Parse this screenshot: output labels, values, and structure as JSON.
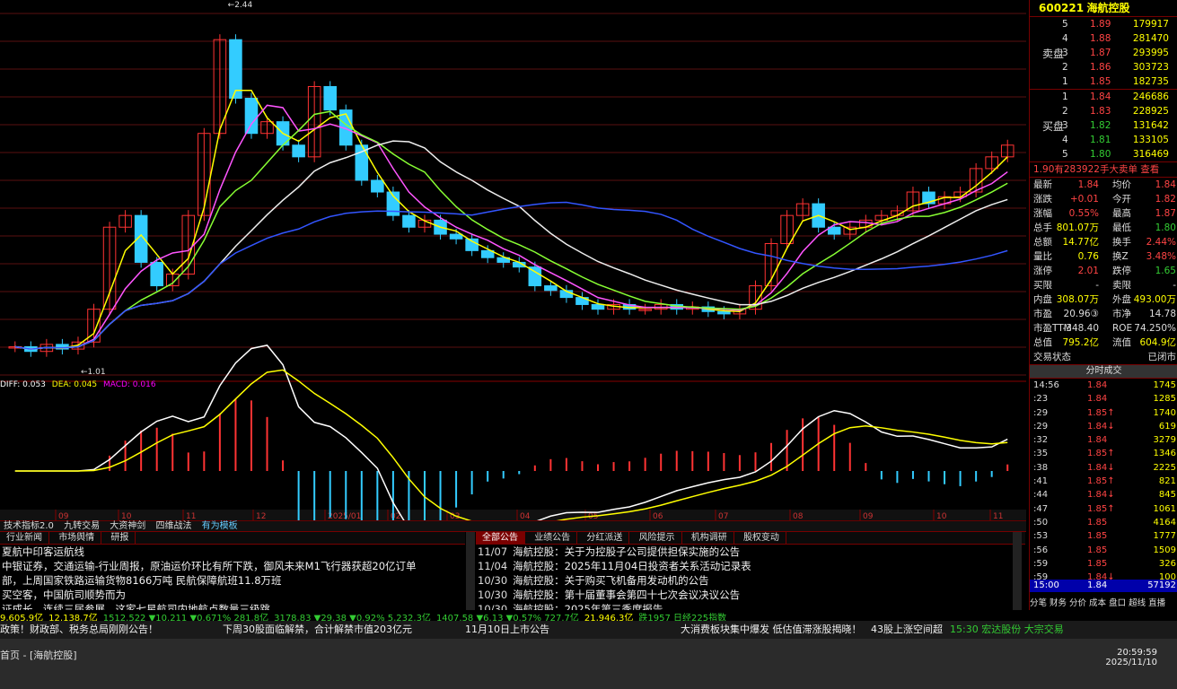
{
  "chart_data": {
    "type": "line",
    "title": "",
    "xlabel": "",
    "ylabel": "",
    "x_ticks": [
      "09",
      "10",
      "11",
      "12",
      "2025/01",
      "02",
      "03",
      "04",
      "05",
      "06",
      "07",
      "08",
      "09",
      "10",
      "11"
    ],
    "price_annotations": {
      "high": "2.44",
      "low": "1.01"
    },
    "candles": [
      1.04,
      1.02,
      1.05,
      1.03,
      1.06,
      1.2,
      1.55,
      1.6,
      1.4,
      1.3,
      1.35,
      1.6,
      1.95,
      2.35,
      2.1,
      1.95,
      2.0,
      1.9,
      1.85,
      2.15,
      2.05,
      1.9,
      1.75,
      1.7,
      1.6,
      1.55,
      1.58,
      1.52,
      1.5,
      1.45,
      1.42,
      1.4,
      1.38,
      1.3,
      1.28,
      1.25,
      1.22,
      1.2,
      1.22,
      1.2,
      1.2,
      1.22,
      1.2,
      1.21,
      1.19,
      1.18,
      1.2,
      1.3,
      1.48,
      1.6,
      1.65,
      1.55,
      1.52,
      1.55,
      1.58,
      1.6,
      1.62,
      1.7,
      1.65,
      1.68,
      1.7,
      1.8,
      1.85,
      1.9
    ],
    "macd": {
      "label_diff": "DIFF: 0.053",
      "label_dea": "DEA: 0.045",
      "label_macd": "MACD: 0.016"
    }
  },
  "bottom_tabs": [
    "技术指标2.0",
    "九转交易",
    "大资神剑",
    "四维战法",
    "有为模板"
  ],
  "left_news": {
    "tabs": [
      "行业新闻",
      "市场舆情",
      "研报"
    ],
    "lines": [
      "夏航中印客运航线",
      "中银证券，交通运输-行业周报，原油运价环比有所下跌，御风未来M1飞行器获超20亿订单",
      "部，上周国家铁路运输货物8166万吨 民航保障航班11.8万班",
      "买空客，中国航司顺势而为",
      "证成长，连续三届参展，这家七星航司内地航点数量三级跳"
    ]
  },
  "right_news": {
    "tabs": [
      "全部公告",
      "业绩公告",
      "分红派送",
      "风险提示",
      "机构调研",
      "股权变动"
    ],
    "items": [
      {
        "date": "11/07",
        "text": "海航控股：关于为控股子公司提供担保实施的公告"
      },
      {
        "date": "11/04",
        "text": "海航控股：2025年11月04日投资者关系活动记录表"
      },
      {
        "date": "10/30",
        "text": "海航控股：关于购买飞机备用发动机的公告"
      },
      {
        "date": "10/30",
        "text": "海航控股：第十届董事会第四十七次会议决议公告"
      },
      {
        "date": "10/30",
        "text": "海航控股：2025年第三季度报告"
      }
    ]
  },
  "ticker": [
    {
      "text": "9,605.9亿",
      "color": "#ff0"
    },
    {
      "text": "12,138.7亿",
      "color": "#ff0"
    },
    {
      "text": "1512.522 ▼10.211 ▼0.671% 281.8亿",
      "color": "#3c3"
    },
    {
      "text": "3178.83 ▼29.38 ▼0.92% 5,232.3亿",
      "color": "#3c3"
    },
    {
      "text": "1407.58 ▼6.13 ▼0.57% 727.7亿",
      "color": "#3c3"
    },
    {
      "text": "21,946.3亿",
      "color": "#ff0"
    },
    {
      "text": "跌1957 日经225指数",
      "color": "#3c3"
    }
  ],
  "marquee": [
    "政策！财政部、税务总局刚刚公告！",
    "下周30股面临解禁，合计解禁市值203亿元",
    "11月10日上市公告",
    "大消费板块集中爆发 低估值滞涨股揭晓！",
    "43股上涨空间超",
    "15:30 宏达股份 大宗交易"
  ],
  "taskbar": {
    "left": "首页 - [海航控股]",
    "time": "20:59:59",
    "date": "2025/11/10"
  },
  "stock": {
    "code": "600221",
    "name": "海航控股"
  },
  "orderbook": {
    "sell_label": "卖盘",
    "buy_label": "买盘",
    "sell": [
      {
        "lv": "5",
        "px": "1.89",
        "vol": "179917"
      },
      {
        "lv": "4",
        "px": "1.88",
        "vol": "281470"
      },
      {
        "lv": "3",
        "px": "1.87",
        "vol": "293995"
      },
      {
        "lv": "2",
        "px": "1.86",
        "vol": "303723"
      },
      {
        "lv": "1",
        "px": "1.85",
        "vol": "182735"
      }
    ],
    "buy": [
      {
        "lv": "1",
        "px": "1.84",
        "vol": "246686"
      },
      {
        "lv": "2",
        "px": "1.83",
        "vol": "228925"
      },
      {
        "lv": "3",
        "px": "1.82",
        "vol": "131642"
      },
      {
        "lv": "4",
        "px": "1.81",
        "vol": "133105"
      },
      {
        "lv": "5",
        "px": "1.80",
        "vol": "316469"
      }
    ],
    "summary": "1.90有283922手大卖单 查看"
  },
  "quotes": [
    {
      "k1": "最新",
      "v1": "1.84",
      "k2": "均价",
      "v2": "1.84"
    },
    {
      "k1": "涨跌",
      "v1": "+0.01",
      "k2": "今开",
      "v2": "1.82"
    },
    {
      "k1": "涨幅",
      "v1": "0.55%",
      "k2": "最高",
      "v2": "1.87"
    },
    {
      "k1": "总手",
      "v1": "801.07万",
      "k2": "最低",
      "v2": "1.80"
    },
    {
      "k1": "总额",
      "v1": "14.77亿",
      "k2": "换手",
      "v2": "2.44%"
    },
    {
      "k1": "量比",
      "v1": "0.76",
      "k2": "换Z",
      "v2": "3.48%"
    },
    {
      "k1": "涨停",
      "v1": "2.01",
      "k2": "跌停",
      "v2": "1.65"
    },
    {
      "k1": "买限",
      "v1": "-",
      "k2": "卖限",
      "v2": "-"
    },
    {
      "k1": "内盘",
      "v1": "308.07万",
      "k2": "外盘",
      "v2": "493.00万"
    },
    {
      "k1": "市盈",
      "v1": "20.96③",
      "k2": "市净",
      "v2": "14.78"
    },
    {
      "k1": "市盈TTM",
      "v1": "-348.40",
      "k2": "ROE",
      "v2": "74.250%"
    },
    {
      "k1": "总值",
      "v1": "795.2亿",
      "k2": "流值",
      "v2": "604.9亿"
    },
    {
      "k1": "交易状态",
      "v1": "",
      "k2": "",
      "v2": "已闭市"
    }
  ],
  "ticks_title": "分时成交",
  "ticks": [
    {
      "t": "14:56",
      "p": "1.84",
      "v": "1745"
    },
    {
      "t": ":23",
      "p": "1.84",
      "v": "1285"
    },
    {
      "t": ":29",
      "p": "1.85↑",
      "v": "1740"
    },
    {
      "t": ":29",
      "p": "1.84↓",
      "v": "619"
    },
    {
      "t": ":32",
      "p": "1.84",
      "v": "3279"
    },
    {
      "t": ":35",
      "p": "1.85↑",
      "v": "1346"
    },
    {
      "t": ":38",
      "p": "1.84↓",
      "v": "2225"
    },
    {
      "t": ":41",
      "p": "1.85↑",
      "v": "821"
    },
    {
      "t": ":44",
      "p": "1.84↓",
      "v": "845"
    },
    {
      "t": ":47",
      "p": "1.85↑",
      "v": "1061"
    },
    {
      "t": ":50",
      "p": "1.85",
      "v": "4164"
    },
    {
      "t": ":53",
      "p": "1.85",
      "v": "1777"
    },
    {
      "t": ":56",
      "p": "1.85",
      "v": "1509"
    },
    {
      "t": ":59",
      "p": "1.85",
      "v": "326"
    },
    {
      "t": ":59",
      "p": "1.84↓",
      "v": "100"
    }
  ],
  "last_tick": {
    "t": "15:00",
    "p": "1.84",
    "v": "57192"
  },
  "rp_tabs": [
    "分笔",
    "财务",
    "分价",
    "成本",
    "盘口",
    "超线",
    "直播"
  ]
}
